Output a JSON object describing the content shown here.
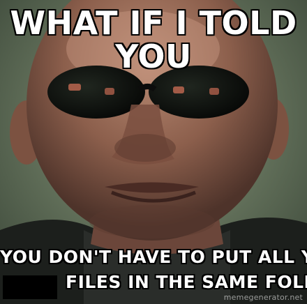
{
  "meme": {
    "top_line_1": "WHAT IF I TOLD",
    "top_line_2": "YOU",
    "bottom_line_1": "YOU DON'T HAVE TO PUT ALL YOUR",
    "bottom_line_2": "FILES IN THE SAME FOLDER",
    "watermark": "memegenerator.net"
  },
  "colors": {
    "caption_fill": "#ffffff",
    "caption_outline": "#000000",
    "redaction": "#000000"
  }
}
